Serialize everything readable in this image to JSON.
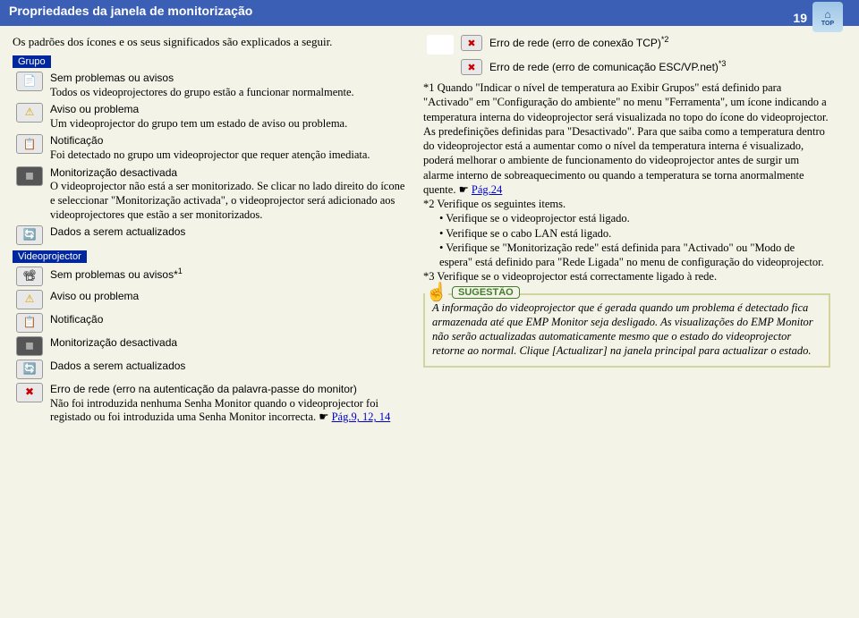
{
  "header": {
    "title": "Propriedades da janela de monitorização",
    "pageNum": "19",
    "topLabel": "TOP"
  },
  "intro": "Os padrões dos ícones e os seus significados são explicados a seguir.",
  "labels": {
    "grupo": "Grupo",
    "videoprojector": "Videoprojector"
  },
  "grupo": [
    {
      "icon": "📄",
      "title": "Sem problemas ou avisos",
      "desc": "Todos os videoprojectores do grupo estão a funcionar normalmente."
    },
    {
      "icon": "⚠",
      "title": "Aviso ou problema",
      "desc": "Um videoprojector do grupo tem um estado de aviso ou problema."
    },
    {
      "icon": "📋",
      "title": "Notificação",
      "desc": "Foi detectado no grupo um videoprojector que requer atenção imediata."
    },
    {
      "icon": "◼",
      "title": "Monitorização desactivada",
      "desc": "O videoprojector não está a ser monitorizado. Se clicar no lado direito do ícone e seleccionar \"Monitorização activada\", o videoprojector será adicionado aos videoprojectores que estão a ser monitorizados."
    },
    {
      "icon": "🔄",
      "title": "Dados a serem actualizados",
      "desc": ""
    }
  ],
  "vp": [
    {
      "icon": "📽",
      "title": "Sem problemas ou avisos*",
      "sup": "1"
    },
    {
      "icon": "⚠",
      "title": "Aviso ou problema"
    },
    {
      "icon": "📋",
      "title": "Notificação"
    },
    {
      "icon": "◼",
      "title": "Monitorização desactivada"
    },
    {
      "icon": "🔄",
      "title": "Dados a serem actualizados"
    },
    {
      "icon": "✖",
      "title": "Erro de rede (erro na autenticação da palavra-passe do monitor)",
      "desc": "Não foi introduzida nenhuma Senha Monitor quando o videoprojector foi registado ou foi introduzida uma Senha Monitor incorrecta. ",
      "linkPrefix": "☛ ",
      "link": "Pág.9, 12, 14"
    }
  ],
  "rightErrors": [
    {
      "icon": "✖",
      "text": "Erro de rede (erro de conexão TCP)",
      "sup": "*2"
    },
    {
      "icon": "✖",
      "text": "Erro de rede (erro de comunicação ESC/VP.net)",
      "sup": "*3"
    }
  ],
  "fn1a": "*1 Quando \"Indicar o nível de temperatura ao Exibir Grupos\" está definido para \"Activado\" em \"Configuração do ambiente\" no menu \"Ferramenta\", um ícone indicando a temperatura interna do videoprojector será visualizada no topo do ícone do videoprojector. As predefinições definidas para \"Desactivado\". Para que saiba como a temperatura dentro do videoprojector está a aumentar como o nível da temperatura interna é visualizado, poderá melhorar o ambiente de funcionamento do videoprojector antes de surgir um alarme interno de sobreaquecimento ou quando a temperatura se torna anormalmente quente. ",
  "fn1link": "Pág.24",
  "fn2": "*2 Verifique os seguintes items.",
  "fn2b1": "• Verifique se o videoprojector está ligado.",
  "fn2b2": "• Verifique se o cabo LAN está ligado.",
  "fn2b3": "• Verifique se \"Monitorização rede\" está definida para \"Activado\" ou \"Modo de espera\" está definido para \"Rede Ligada\" no menu de configuração do videoprojector.",
  "fn3": "*3 Verifique se o videoprojector está correctamente ligado à rede.",
  "tip": {
    "label": "SUGESTÃO",
    "text": "A informação do videoprojector que é gerada quando um problema é detectado fica armazenada até que EMP Monitor seja desligado. As visualizações do EMP Monitor não serão actualizadas automaticamente mesmo que o estado do videoprojector retorne ao normal. Clique [Actualizar] na janela principal para actualizar o estado."
  }
}
